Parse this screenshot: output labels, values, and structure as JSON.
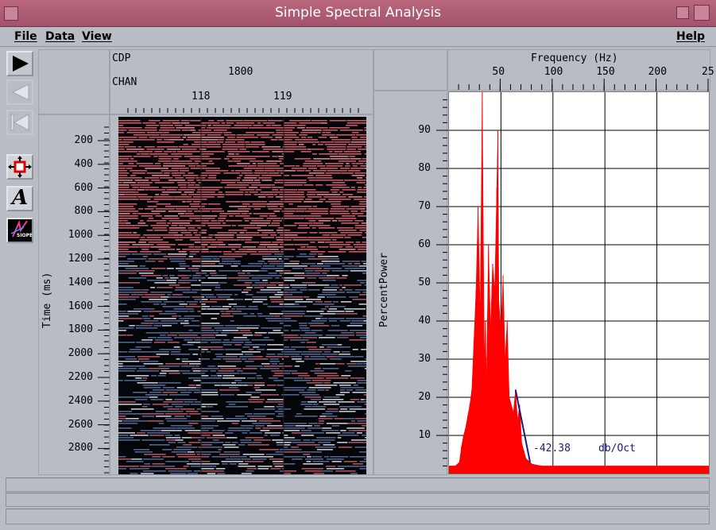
{
  "window": {
    "title": "Simple Spectral Analysis"
  },
  "menu": {
    "file": "File",
    "data": "Data",
    "view": "View",
    "help": "Help"
  },
  "toolbar": {
    "play": "play-icon",
    "step_back": "step-back-icon",
    "rewind": "rewind-icon",
    "zoom": "zoom-move-icon",
    "annotate_label": "A",
    "logo_label": "SIOPE"
  },
  "seismic": {
    "cdp_label": "CDP",
    "cdp_value": "1800",
    "chan_label": "CHAN",
    "chan_ticks": [
      "118",
      "119"
    ],
    "time_axis_label": "Time (ms)",
    "time_ticks": [
      "200",
      "400",
      "600",
      "800",
      "1000",
      "1200",
      "1400",
      "1600",
      "1800",
      "2000",
      "2200",
      "2400",
      "2600",
      "2800"
    ]
  },
  "spectrum": {
    "x_axis_label": "Frequency (Hz)",
    "y_axis_label": "PercentPower",
    "slope_value": "-42.38",
    "slope_unit": "db/Oct",
    "colors": {
      "spectrum": "#ff0000",
      "slope_line": "#1a1a80",
      "background": "#ffffff"
    }
  },
  "chart_data": {
    "type": "area",
    "xlabel": "Frequency (Hz)",
    "ylabel": "PercentPower",
    "xlim": [
      0,
      250
    ],
    "ylim": [
      0,
      100
    ],
    "x_ticks": [
      "50",
      "100",
      "150",
      "200",
      "25"
    ],
    "y_ticks": [
      "10",
      "20",
      "30",
      "40",
      "50",
      "60",
      "70",
      "80",
      "90"
    ],
    "grid": true,
    "x": [
      0,
      6,
      10,
      12,
      14,
      16,
      18,
      20,
      22,
      24,
      26,
      28,
      30,
      32,
      34,
      35,
      36,
      38,
      40,
      42,
      44,
      46,
      47,
      48,
      50,
      52,
      54,
      56,
      58,
      60,
      62,
      64,
      66,
      68,
      70,
      72,
      74,
      76,
      78,
      80,
      85,
      90,
      100,
      150,
      200,
      250
    ],
    "y": [
      2,
      2,
      3,
      7,
      10,
      12,
      15,
      18,
      22,
      35,
      48,
      70,
      42,
      100,
      30,
      40,
      24,
      60,
      38,
      55,
      48,
      75,
      90,
      45,
      38,
      52,
      30,
      40,
      20,
      18,
      16,
      22,
      14,
      18,
      8,
      6,
      4,
      3.5,
      3,
      2.5,
      2.2,
      2,
      2,
      2,
      2,
      2
    ],
    "annotations": [
      {
        "text": "-42.38",
        "x": 78,
        "y": 3
      },
      {
        "text": "db/Oct",
        "x": 140,
        "y": 3
      }
    ],
    "slope_line": {
      "x": [
        64,
        78
      ],
      "y": [
        22,
        3
      ]
    }
  },
  "status": {
    "line1": "",
    "line2": ""
  }
}
